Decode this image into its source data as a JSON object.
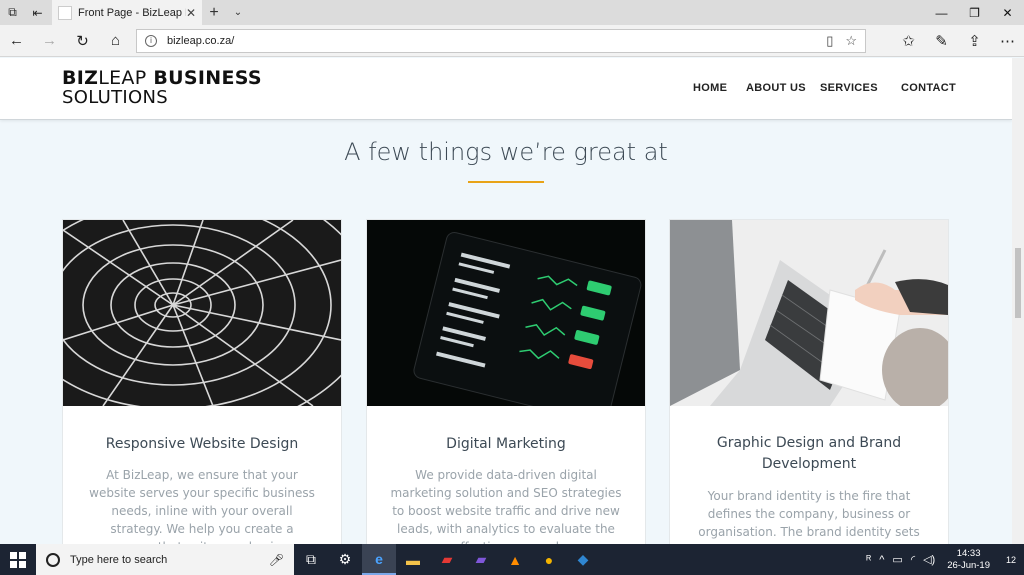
{
  "browser": {
    "tab_title": "Front Page - BizLeap Bu",
    "tab_close": "✕",
    "new_tab": "+",
    "url": "bizleap.co.za/"
  },
  "site": {
    "logo_line1_bold": "BIZ",
    "logo_line1_light": "LEAP",
    "logo_line1_end": " BUSINESS",
    "logo_line2": "SOLUTIONS",
    "nav": [
      "HOME",
      "ABOUT US",
      "SERVICES",
      "CONTACT"
    ]
  },
  "section": {
    "title": "A few things we’re great at"
  },
  "cards": [
    {
      "title": "Responsive Website Design",
      "text": "At BizLeap, we ensure that your website serves your specific business needs, inline with your overall strategy. We help you create a presence that suits your business,"
    },
    {
      "title": "Digital Marketing",
      "text": "We provide data-driven digital marketing solution and SEO strategies to boost website traffic and drive new leads, with analytics to evaluate the effectiveness and"
    },
    {
      "title": "Graphic Design and Brand Development",
      "text": "Your brand identity is the fire that defines the company, business or organisation. The brand identity sets the company apart"
    }
  ],
  "taskbar": {
    "search_placeholder": "Type here to search",
    "time": "14:33",
    "date": "26-Jun-19",
    "notifications": "12"
  },
  "colors": {
    "accent_underline": "#e8a317",
    "taskbar": "#1c2433",
    "page_bg": "#f0f7fb"
  }
}
